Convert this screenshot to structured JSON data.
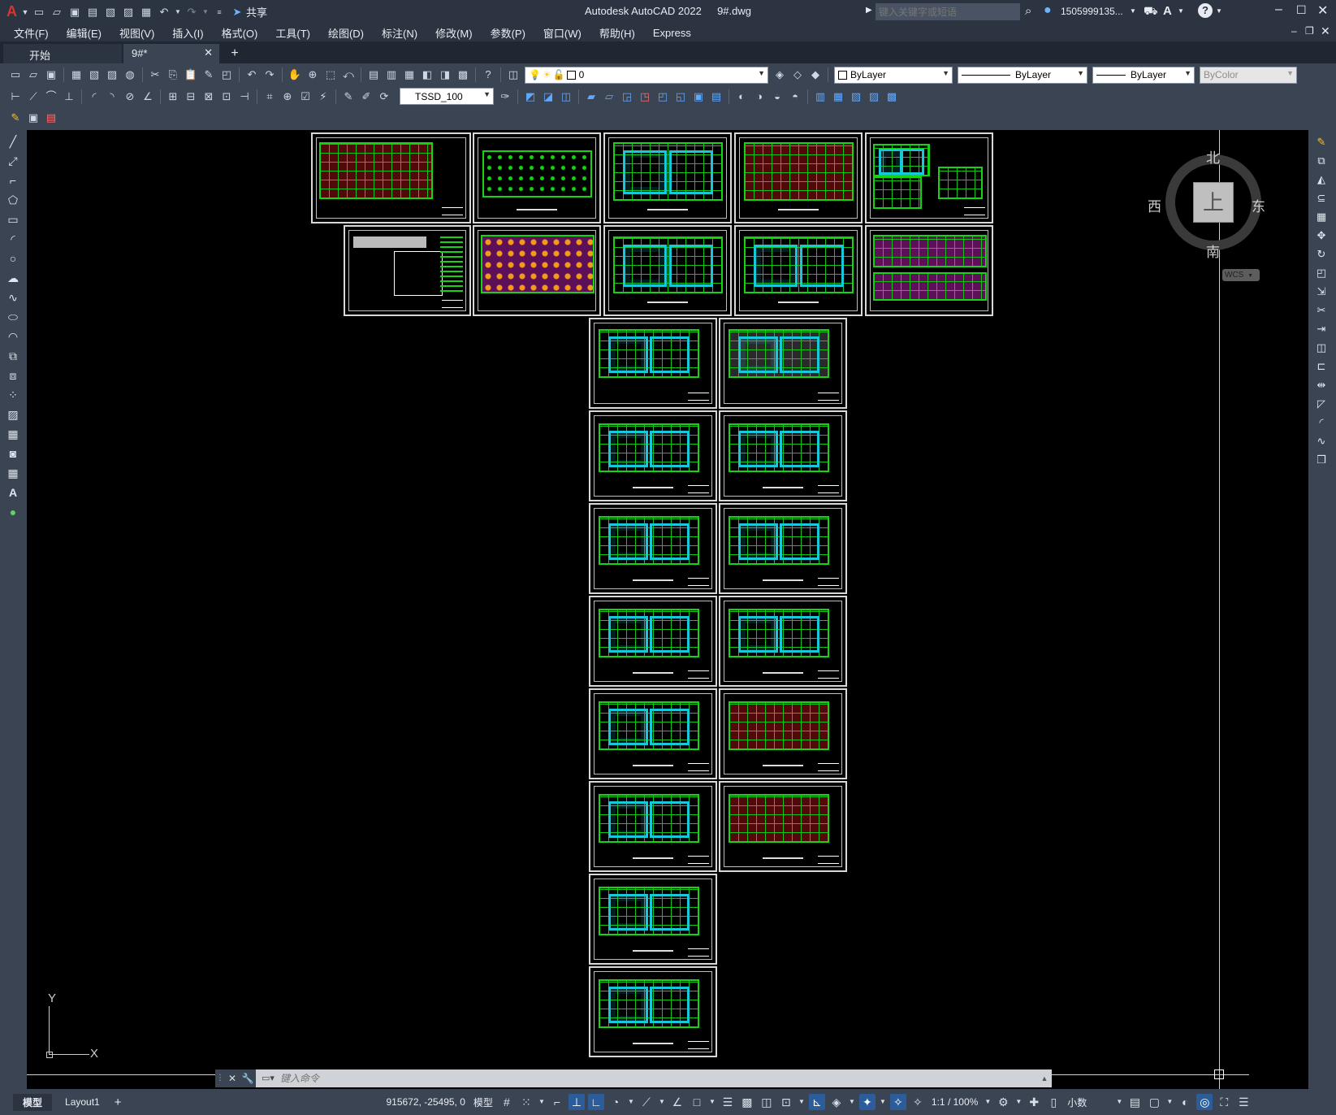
{
  "app": {
    "title": "Autodesk AutoCAD 2022",
    "file": "9#.dwg",
    "logo_letter": "A",
    "share_label": "共享",
    "search_placeholder": "键入关键字或短语",
    "user": "1505999135...",
    "help_icon": "question-icon"
  },
  "menu": [
    "文件(F)",
    "编辑(E)",
    "视图(V)",
    "插入(I)",
    "格式(O)",
    "工具(T)",
    "绘图(D)",
    "标注(N)",
    "修改(M)",
    "参数(P)",
    "窗口(W)",
    "帮助(H)",
    "Express"
  ],
  "tabs": [
    {
      "label": "开始",
      "active": false
    },
    {
      "label": "9#*",
      "active": true
    }
  ],
  "toolbar": {
    "layer_value": "0",
    "color_value": "ByLayer",
    "linetype_value": "ByLayer",
    "lineweight_value": "ByLayer",
    "plotstyle_value": "ByColor",
    "dimstyle_value": "TSSD_100"
  },
  "viewcube": {
    "north": "北",
    "south": "南",
    "east": "东",
    "west": "西",
    "top": "上",
    "wcs": "WCS"
  },
  "ucs": {
    "x": "X",
    "y": "Y"
  },
  "command": {
    "placeholder": "键入命令"
  },
  "layout_tabs": [
    "模型",
    "Layout1"
  ],
  "status": {
    "coords": "915672, -25495, 0",
    "model": "模型",
    "scale": "1:1 / 100%",
    "units": "小数"
  },
  "colors": {
    "background": "#000000",
    "ui": "#3b4453",
    "plan_green": "#14d414",
    "plan_cyan": "#17c8d8",
    "accent": "#2b5d9a"
  }
}
